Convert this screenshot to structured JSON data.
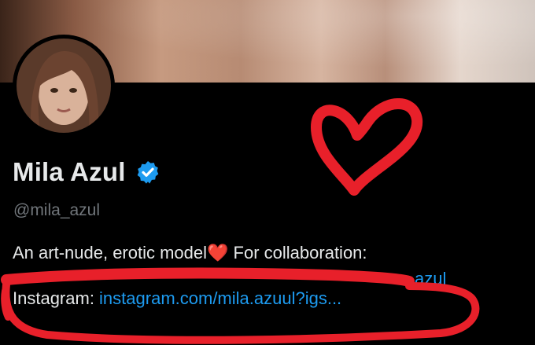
{
  "profile": {
    "display_name": "Mila Azul",
    "handle": "@mila_azul",
    "verified_icon": "verified-badge-icon",
    "accent_color": "#1d9bf0"
  },
  "bio": {
    "line1_text": "An art-nude, erotic model",
    "line1_emoji": "❤️",
    "line1_suffix": " For collaboration:",
    "line2_visible_link_fragment": "azul",
    "instagram_label": "Instagram: ",
    "instagram_link": "instagram.com/mila.azuul?igs..."
  },
  "annotations": {
    "heart_doodle_color": "#e8202a",
    "redaction_color": "#e8202a"
  }
}
